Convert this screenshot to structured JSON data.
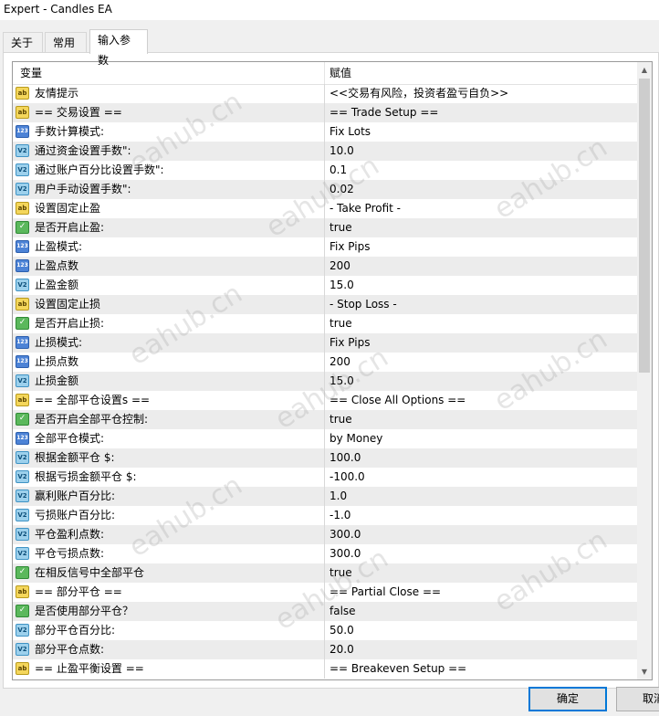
{
  "window": {
    "title": "Expert - Candles EA"
  },
  "tabs": [
    {
      "label": "关于"
    },
    {
      "label": "常用"
    },
    {
      "label": "输入参数"
    }
  ],
  "grid": {
    "header_name": "变量",
    "header_value": "赋值"
  },
  "rows": [
    {
      "icon": "string-icon",
      "name": "友情提示",
      "value": "<<交易有风险，投资者盈亏自负>>"
    },
    {
      "icon": "string-icon",
      "name": "== 交易设置  ==",
      "value": "== Trade Setup =="
    },
    {
      "icon": "integer-icon",
      "name": "手数计算模式:",
      "value": "Fix Lots"
    },
    {
      "icon": "double-icon",
      "name": "通过资金设置手数\":",
      "value": "10.0"
    },
    {
      "icon": "double-icon",
      "name": "通过账户百分比设置手数\":",
      "value": "0.1"
    },
    {
      "icon": "double-icon",
      "name": "用户手动设置手数\":",
      "value": "0.02"
    },
    {
      "icon": "string-icon",
      "name": "设置固定止盈",
      "value": "- Take Profit -"
    },
    {
      "icon": "bool-icon",
      "name": "是否开启止盈:",
      "value": "true"
    },
    {
      "icon": "integer-icon",
      "name": "止盈模式:",
      "value": "Fix Pips"
    },
    {
      "icon": "integer-icon",
      "name": "止盈点数",
      "value": "200"
    },
    {
      "icon": "double-icon",
      "name": "止盈金额",
      "value": "15.0"
    },
    {
      "icon": "string-icon",
      "name": "设置固定止损",
      "value": "- Stop Loss -"
    },
    {
      "icon": "bool-icon",
      "name": "是否开启止损:",
      "value": "true"
    },
    {
      "icon": "integer-icon",
      "name": "止损模式:",
      "value": "Fix Pips"
    },
    {
      "icon": "integer-icon",
      "name": "止损点数",
      "value": "200"
    },
    {
      "icon": "double-icon",
      "name": "止损金额",
      "value": "15.0"
    },
    {
      "icon": "string-icon",
      "name": "== 全部平仓设置s ==",
      "value": "== Close All Options =="
    },
    {
      "icon": "bool-icon",
      "name": "是否开启全部平仓控制:",
      "value": "true"
    },
    {
      "icon": "integer-icon",
      "name": "全部平仓模式:",
      "value": "by Money"
    },
    {
      "icon": "double-icon",
      "name": "根据金额平仓 $:",
      "value": "100.0"
    },
    {
      "icon": "double-icon",
      "name": "根据亏损金额平仓  $:",
      "value": "-100.0"
    },
    {
      "icon": "double-icon",
      "name": "赢利账户百分比:",
      "value": "1.0"
    },
    {
      "icon": "double-icon",
      "name": "亏损账户百分比:",
      "value": "-1.0"
    },
    {
      "icon": "double-icon",
      "name": "平仓盈利点数:",
      "value": "300.0"
    },
    {
      "icon": "double-icon",
      "name": "平仓亏损点数:",
      "value": "300.0"
    },
    {
      "icon": "bool-icon",
      "name": "在相反信号中全部平仓",
      "value": "true"
    },
    {
      "icon": "string-icon",
      "name": "== 部分平仓 ==",
      "value": "== Partial Close =="
    },
    {
      "icon": "bool-icon",
      "name": "是否使用部分平仓？",
      "value": "false"
    },
    {
      "icon": "double-icon",
      "name": "部分平仓百分比:",
      "value": "50.0"
    },
    {
      "icon": "double-icon",
      "name": "部分平仓点数:",
      "value": "20.0"
    },
    {
      "icon": "string-icon",
      "name": "== 止盈平衡设置 ==",
      "value": "== Breakeven Setup =="
    }
  ],
  "icon_glyphs": {
    "string-icon": "ab",
    "integer-icon": "123",
    "double-icon": "V2",
    "bool-icon": "✓"
  },
  "watermark": "eahub.cn",
  "buttons": {
    "ok": "确定",
    "cancel": "取消"
  }
}
